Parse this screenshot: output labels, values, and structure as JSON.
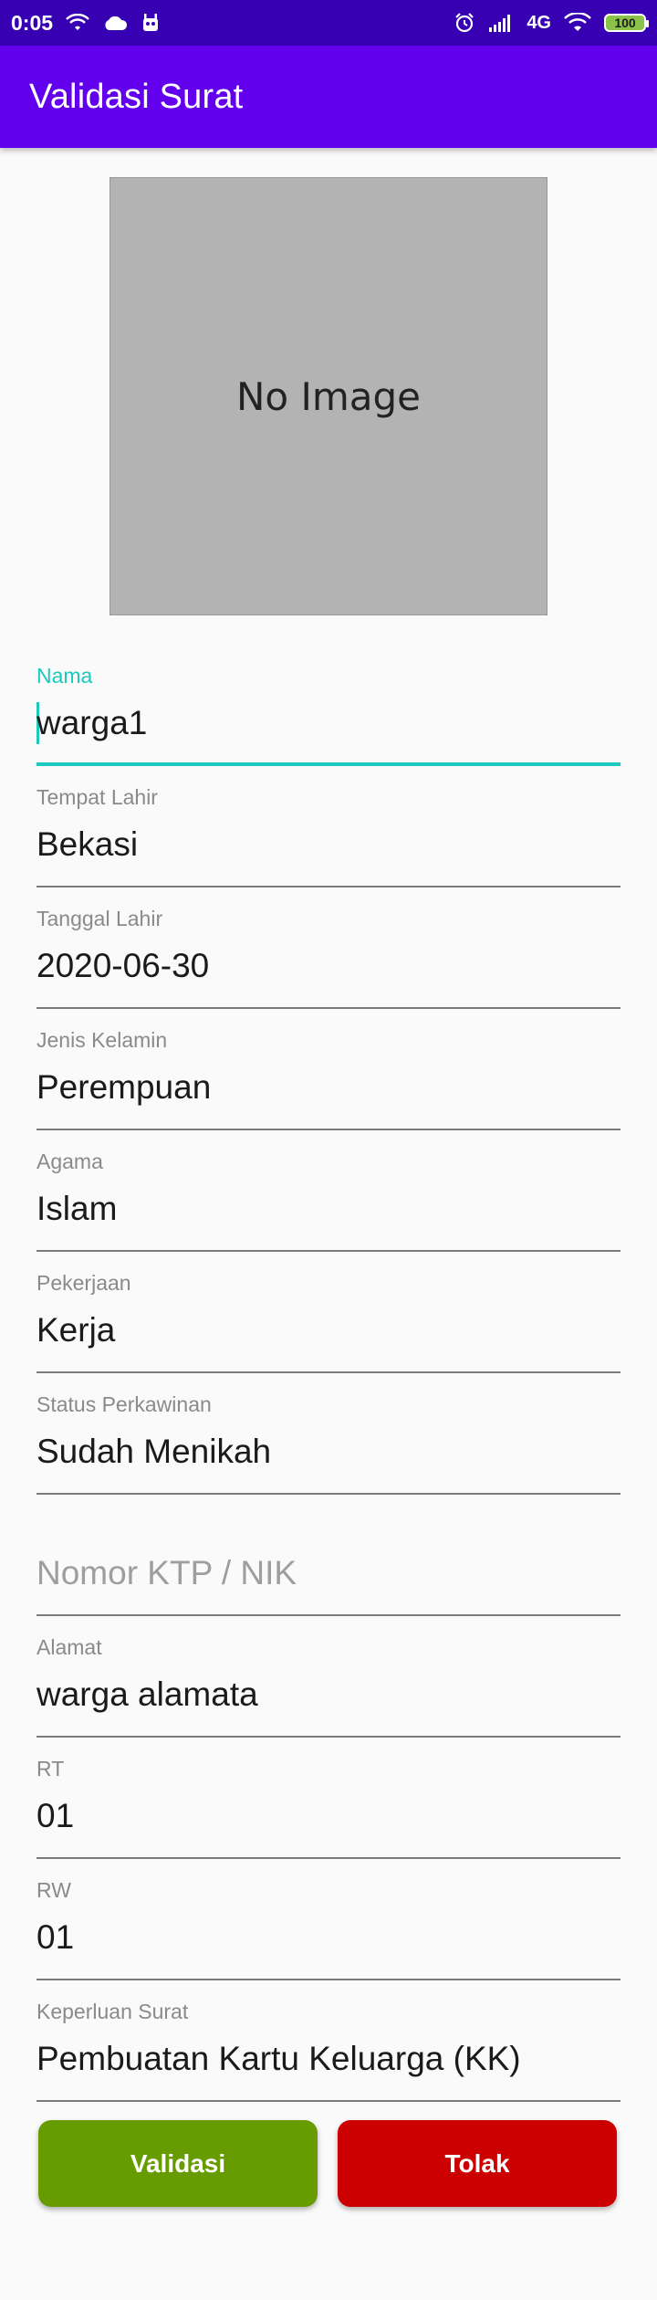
{
  "status_bar": {
    "time": "0:05",
    "network": "4G",
    "battery": "100"
  },
  "app_bar": {
    "title": "Validasi Surat"
  },
  "photo": {
    "placeholder_text": "No Image"
  },
  "form": {
    "fields": [
      {
        "label": "Nama",
        "value": "warga1"
      },
      {
        "label": "Tempat Lahir",
        "value": "Bekasi"
      },
      {
        "label": "Tanggal Lahir",
        "value": "2020-06-30"
      },
      {
        "label": "Jenis Kelamin",
        "value": "Perempuan"
      },
      {
        "label": "Agama",
        "value": "Islam"
      },
      {
        "label": "Pekerjaan",
        "value": "Kerja"
      },
      {
        "label": "Status Perkawinan",
        "value": "Sudah Menikah"
      },
      {
        "label": "",
        "value": "",
        "placeholder": "Nomor KTP / NIK"
      },
      {
        "label": "Alamat",
        "value": "warga alamata"
      },
      {
        "label": "RT",
        "value": "01"
      },
      {
        "label": "RW",
        "value": "01"
      },
      {
        "label": "Keperluan Surat",
        "value": "Pembuatan Kartu Keluarga (KK)"
      }
    ]
  },
  "actions": {
    "validate_label": "Validasi",
    "reject_label": "Tolak"
  },
  "colors": {
    "status_bar": "#3700b3",
    "app_bar": "#6200ee",
    "focus_accent": "#1cc9c0",
    "validate_button": "#669c00",
    "reject_button": "#cc0000"
  }
}
